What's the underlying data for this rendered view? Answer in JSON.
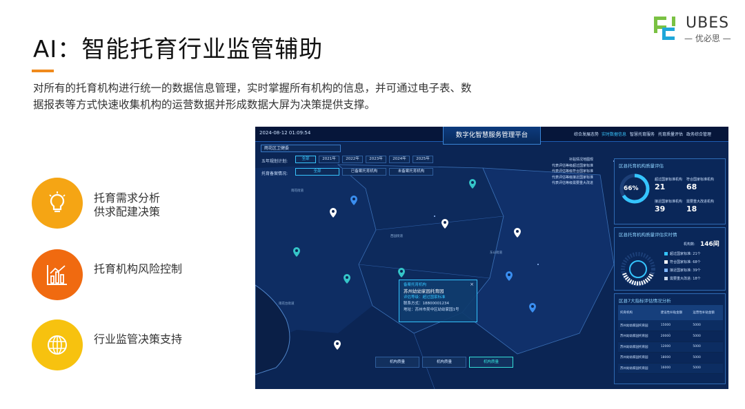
{
  "slide": {
    "title": "AI：智能托育行业监管辅助",
    "description": "对所有的托育机构进行统一的数据信息管理，实时掌握所有机构的信息，并可通过电子表、数据报表等方式快速收集机构的运营数据并形成数据大屏为决策提供支撑。",
    "accent_color": "#f08a1c"
  },
  "logo": {
    "name": "UBES",
    "subtitle": "— 优必思 —"
  },
  "features": [
    {
      "label_line1": "托育需求分析",
      "label_line2": "供求配建决策",
      "icon": "lightbulb-icon",
      "color": "#f5a514"
    },
    {
      "label_line1": "托育机构风险控制",
      "label_line2": "",
      "icon": "bar-chart-icon",
      "color": "#f06a10"
    },
    {
      "label_line1": "行业监管决策支持",
      "label_line2": "",
      "icon": "globe-icon",
      "color": "#f7c20f"
    }
  ],
  "dashboard": {
    "datetime": "2024-08-12   01:09:54",
    "platform_title": "数字化智慧服务管理平台",
    "nav": [
      "综合发展态势",
      "实时数据信息",
      "智慧托育服务",
      "托育质量评估",
      "政务综合管理"
    ],
    "active_nav": "实时数据信息",
    "region_select": "雨花区卫健委",
    "filters": {
      "plan_label": "五年规划计划:",
      "plan_options": [
        "全部",
        "2021年",
        "2022年",
        "2023年",
        "2024年",
        "2025年"
      ],
      "record_label": "托育备案情况:",
      "record_options": [
        "全部",
        "已备案托育机构",
        "未备案托育机构"
      ]
    },
    "legend": [
      "补贴情况地图规",
      "代表评估等级超过国家标准",
      "代表评估等级符合国家标准",
      "代表评估等级接近国家标准",
      "代表评估等级需要重大改进"
    ],
    "places": [
      "雨花街道",
      "西园街道",
      "雨花台街道",
      "东山街道"
    ],
    "popup": {
      "status": "备案托育机构",
      "name": "苏州幼幼家园托育园",
      "grade": "评估等级：超过国家标准",
      "phone": "联系方式：18800001234",
      "address": "地址：苏州市吴中区幼幼家园1号",
      "close": "×"
    },
    "bottom_buttons": [
      "机构质量",
      "机构质量",
      "机构质量"
    ],
    "quality_panel": {
      "title": "区县托育机构质量评估",
      "gauge_value": "66%",
      "stats": [
        {
          "label": "超过国家标准机构",
          "value": "21"
        },
        {
          "label": "符合国家标准机构",
          "value": "68"
        },
        {
          "label": "接近国家标准机构",
          "value": "39"
        },
        {
          "label": "需要重大改进机构",
          "value": "18"
        }
      ]
    },
    "realtime_panel": {
      "title": "区县托育机构质量评估实时情",
      "count_label": "机构数:",
      "count_value": "146间",
      "items": [
        {
          "label": "超过国家标准:",
          "value": "21个",
          "color": "#35c5ff"
        },
        {
          "label": "符合国家标准:",
          "value": "68个",
          "color": "#ffffff"
        },
        {
          "label": "接近国家标准:",
          "value": "39个",
          "color": "#7fb7ff"
        },
        {
          "label": "需要重大改进:",
          "value": "18个",
          "color": "#c8d6ea"
        }
      ]
    },
    "table_panel": {
      "title": "区县7大指标评估情况分析",
      "headers": [
        "托育机构",
        "建设性补贴金额",
        "运营性补贴金额"
      ],
      "rows": [
        [
          "苏州幼幼家园托育园",
          "15000",
          "5000"
        ],
        [
          "苏州幼幼家园托育园",
          "20000",
          "5000"
        ],
        [
          "苏州幼幼家园托育园",
          "12000",
          "5000"
        ],
        [
          "苏州幼幼家园托育园",
          "18000",
          "5000"
        ],
        [
          "苏州幼幼家园托育园",
          "16000",
          "5000"
        ]
      ]
    }
  }
}
